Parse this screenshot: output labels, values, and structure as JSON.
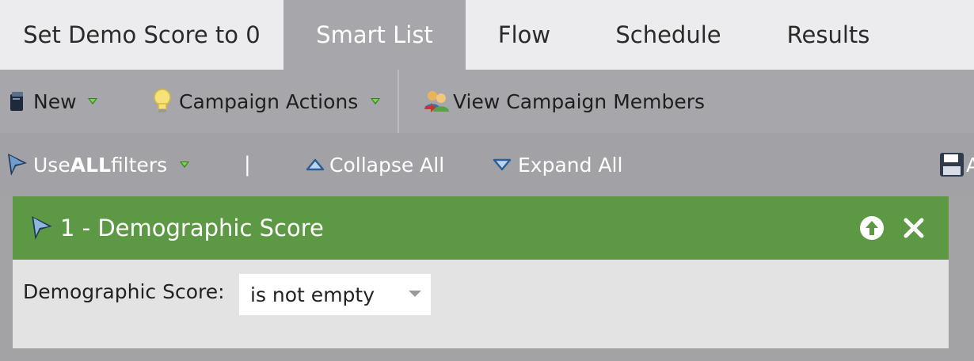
{
  "tabs": [
    {
      "label": "Set Demo Score to 0",
      "active": false
    },
    {
      "label": "Smart List",
      "active": true
    },
    {
      "label": "Flow",
      "active": false
    },
    {
      "label": "Schedule",
      "active": false
    },
    {
      "label": "Results",
      "active": false
    }
  ],
  "toolbar": {
    "new_label": "New",
    "campaign_actions_label": "Campaign Actions",
    "view_members_label": "View Campaign Members"
  },
  "filterbar": {
    "use_prefix": "Use ",
    "use_bold": "ALL",
    "use_suffix": " filters",
    "separator": "|",
    "collapse_label": "Collapse All",
    "expand_label": "Expand All",
    "save_label": "A"
  },
  "filter": {
    "title": "1 - Demographic Score",
    "field_label": "Demographic Score:",
    "operator_value": "is not empty"
  },
  "colors": {
    "header_green": "#5d9944",
    "active_tab": "#a7a7ab",
    "tab_bg": "#ececee"
  }
}
